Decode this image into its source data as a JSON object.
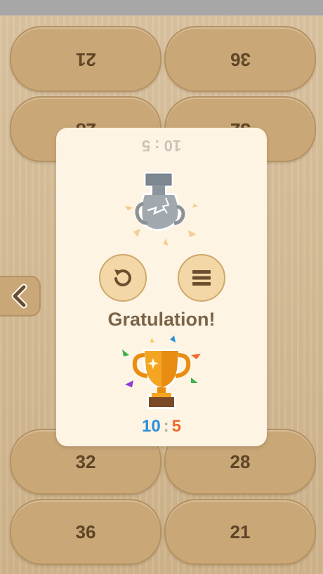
{
  "board": {
    "pills": [
      {
        "value": "21",
        "flipped": true
      },
      {
        "value": "36",
        "flipped": true
      },
      {
        "value": "28",
        "flipped": true
      },
      {
        "value": "32",
        "flipped": true
      },
      {
        "value": "32",
        "flipped": false
      },
      {
        "value": "28",
        "flipped": false
      },
      {
        "value": "36",
        "flipped": false
      },
      {
        "value": "21",
        "flipped": false
      }
    ]
  },
  "modal": {
    "top_score": "10 : 5",
    "title": "Gratulation!",
    "score_left": "10",
    "score_sep": ":",
    "score_right": "5",
    "buttons": {
      "restart_icon": "restart-icon",
      "menu_icon": "menu-icon"
    }
  },
  "icons": {
    "back": "chevron-left-icon",
    "broken_trophy": "broken-trophy-icon",
    "trophy": "trophy-icon"
  },
  "colors": {
    "score_left": "#2e8fd8",
    "score_right": "#ee6a2c",
    "title": "#7a6448",
    "modal_bg": "#fef4e4"
  }
}
